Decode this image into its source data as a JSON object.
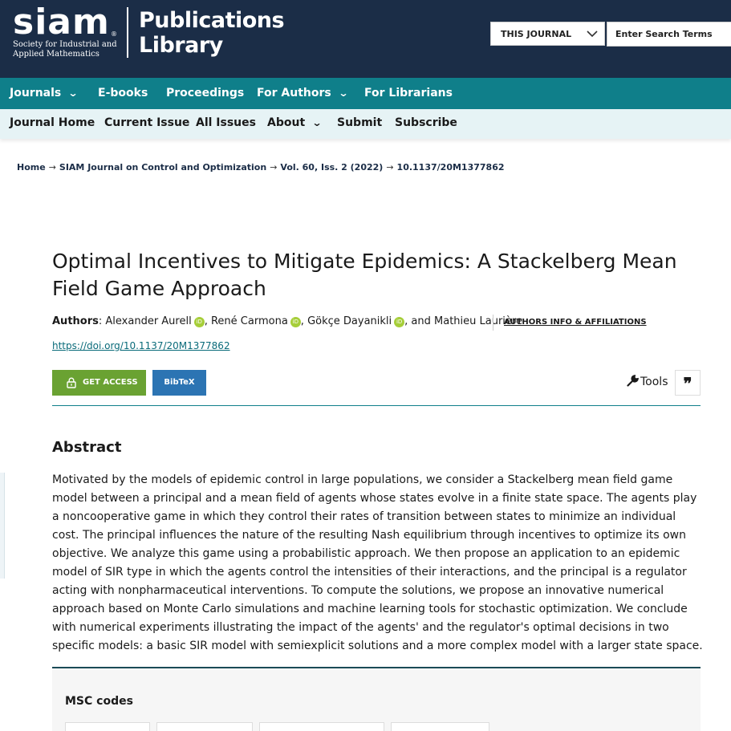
{
  "header": {
    "logo_word": "siam",
    "logo_reg": "®",
    "logo_subtitle": "Society for Industrial and Applied Mathematics",
    "product_title": "Publications Library",
    "search_scope": "THIS JOURNAL",
    "search_placeholder": "Enter Search Terms"
  },
  "main_nav": [
    "Journals",
    "E-books",
    "Proceedings",
    "For Authors",
    "For Librarians"
  ],
  "sub_nav": [
    "Journal Home",
    "Current Issue",
    "All Issues",
    "About",
    "Submit",
    "Subscribe"
  ],
  "breadcrumb": [
    "Home",
    "SIAM Journal on Control and Optimization",
    "Vol. 60, Iss. 2 (2022)",
    "10.1137/20M1377862"
  ],
  "article": {
    "title": "Optimal Incentives to Mitigate Epidemics: A Stackelberg Mean Field Game Approach",
    "authors_label": "Authors",
    "authors": [
      "Alexander Aurell",
      "René Carmona",
      "Gökçe Dayanikli",
      "Mathieu Laurière"
    ],
    "and_word": "and",
    "affiliations_link": "AUTHORS INFO & AFFILIATIONS",
    "doi": "https://doi.org/10.1137/20M1377862",
    "get_access": "GET ACCESS",
    "bibtex": "BibTeX",
    "tools": "Tools",
    "cite_glyph": "❞"
  },
  "abstract": {
    "heading": "Abstract",
    "text": "Motivated by the models of epidemic control in large populations, we consider a Stackelberg mean field game model between a principal and a mean field of agents whose states evolve in a finite state space. The agents play a noncooperative game in which they control their rates of transition between states to minimize an individual cost. The principal influences the nature of the resulting Nash equilibrium through incentives to optimize its own objective. We analyze this game using a probabilistic approach. We then propose an application to an epidemic model of SIR type in which the agents control the intensities of their interactions, and the principal is a regulator acting with nonpharmaceutical interventions. To compute the solutions, we propose an innovative numerical approach based on Monte Carlo simulations and machine learning tools for stochastic optimization. We conclude with numerical experiments illustrating the impact of the agents' and the regulator's optimal decisions in two specific models: a basic SIR model with semiexplicit solutions and a more complex model with a larger state space."
  },
  "msc": {
    "heading": "MSC codes"
  },
  "colors": {
    "header_bg": "#1b2d47",
    "nav_teal": "#0f7f8a",
    "access_green": "#6aa232",
    "bibtex_blue": "#2c74b3",
    "orcid_green": "#a6ce39"
  }
}
